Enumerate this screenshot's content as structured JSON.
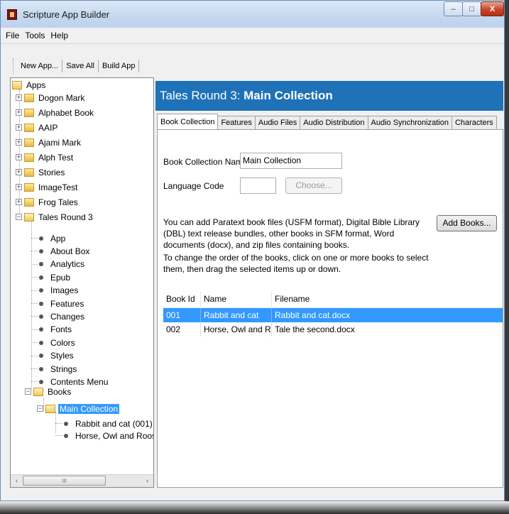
{
  "window": {
    "title": "Scripture App Builder",
    "min": "–",
    "max": "□",
    "close": "X"
  },
  "menu": [
    "File",
    "Tools",
    "Help"
  ],
  "toolbar": {
    "new_app": "New App...",
    "save_all": "Save All",
    "build_app": "Build App"
  },
  "tree": {
    "root": "Apps",
    "apps": [
      "Dogon Mark",
      "Alphabet Book",
      "AAIP",
      "Ajami Mark",
      "Alph Test",
      "Stories",
      "ImageTest",
      "Frog Tales",
      "Tales Round 3"
    ],
    "tales_children": [
      "App",
      "About Box",
      "Analytics",
      "Epub",
      "Images",
      "Features",
      "Changes",
      "Fonts",
      "Colors",
      "Styles",
      "Strings",
      "Contents Menu"
    ],
    "books_label": "Books",
    "collection_label": "Main Collection",
    "collection_books": [
      "Rabbit and cat (001)",
      "Horse, Owl and Rooster ("
    ],
    "scroll_left": "‹",
    "scroll_right": "›",
    "scroll_grip": "III"
  },
  "header": {
    "prefix": "Tales Round 3: ",
    "title": "Main Collection"
  },
  "tabs": [
    "Book Collection",
    "Features",
    "Audio Files",
    "Audio Distribution",
    "Audio Synchronization",
    "Characters"
  ],
  "form": {
    "collection_name_label": "Book Collection Name",
    "collection_name_value": "Main Collection",
    "language_code_label": "Language Code",
    "language_code_value": "",
    "choose_button": "Choose...",
    "add_books_button": "Add Books...",
    "help_1": "You can add Paratext book files (USFM format), Digital Bible Library (DBL) text release bundles, other books in SFM format, Word documents (docx), and zip files containing books.",
    "help_2": "To change the order of the books, click on one or more books to select them, then drag the selected items up or down."
  },
  "books_table": {
    "headers": [
      "Book Id",
      "Name",
      "Filename"
    ],
    "rows": [
      {
        "id": "001",
        "name": "Rabbit and cat",
        "filename": "Rabbit and cat.docx",
        "selected": true
      },
      {
        "id": "002",
        "name": "Horse, Owl and Ro...",
        "filename": "Tale the second.docx",
        "selected": false
      }
    ]
  }
}
